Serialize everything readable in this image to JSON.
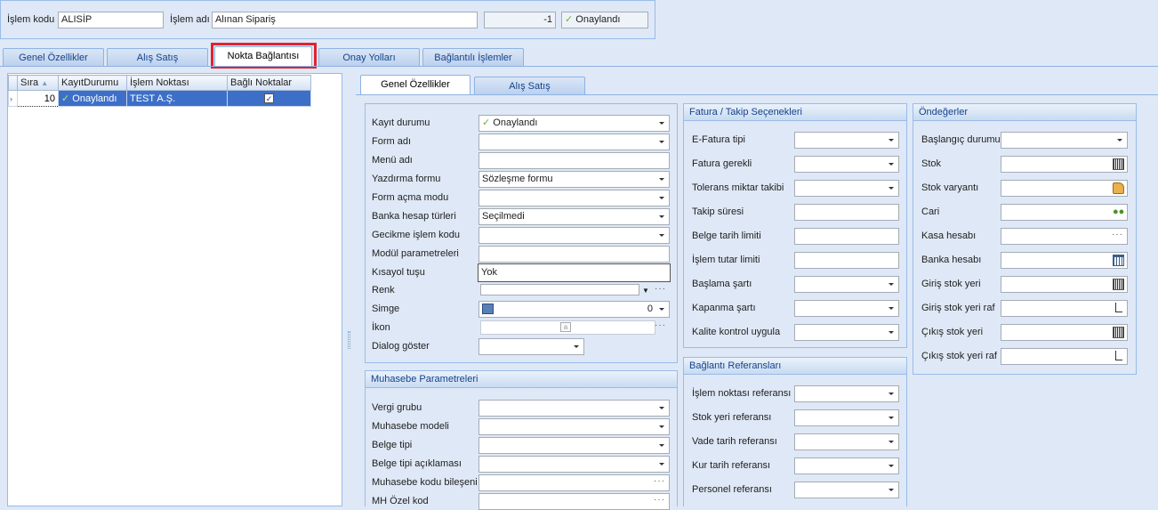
{
  "top": {
    "islem_kodu_label": "İşlem kodu",
    "islem_kodu_value": "ALISİP",
    "islem_adi_label": "İşlem adı",
    "islem_adi_value": "Alınan Sipariş",
    "number_value": "-1",
    "status_value": "Onaylandı"
  },
  "main_tabs": [
    "Genel Özellikler",
    "Alış Satış",
    "Nokta Bağlantısı",
    "Onay Yolları",
    "Bağlantılı İşlemler"
  ],
  "grid": {
    "headers": [
      "Sıra",
      "KayıtDurumu",
      "İşlem Noktası",
      "Bağlı Noktalar"
    ],
    "row": {
      "sira": "10",
      "durum": "Onaylandı",
      "nokta": "TEST A.Ş.",
      "bagli": "✓"
    }
  },
  "sub_tabs": [
    "Genel Özellikler",
    "Alış Satış"
  ],
  "genel": {
    "labels": [
      "Kayıt durumu",
      "Form adı",
      "Menü adı",
      "Yazdırma formu",
      "Form açma modu",
      "Banka hesap türleri",
      "Gecikme işlem kodu",
      "Modül parametreleri",
      "Kısayol tuşu",
      "Renk",
      "Simge",
      "İkon",
      "Dialog göster"
    ],
    "kayit_durumu": "Onaylandı",
    "yazdirma_formu": "Sözleşme formu",
    "banka_hesap": "Seçilmedi",
    "kisayol": "Yok",
    "simge_value": "0"
  },
  "muhasebe": {
    "title": "Muhasebe Parametreleri",
    "labels": [
      "Vergi grubu",
      "Muhasebe modeli",
      "Belge tipi",
      "Belge tipi açıklaması",
      "Muhasebe kodu bileşeni",
      "MH Özel kod"
    ]
  },
  "fatura": {
    "title": "Fatura / Takip Seçenekleri",
    "labels": [
      "E-Fatura tipi",
      "Fatura gerekli",
      "Tolerans miktar takibi",
      "Takip süresi",
      "Belge tarih limiti",
      "İşlem tutar limiti",
      "Başlama şartı",
      "Kapanma şartı",
      "Kalite kontrol uygula"
    ]
  },
  "baglanti": {
    "title": "Bağlantı Referansları",
    "labels": [
      "İşlem noktası referansı",
      "Stok yeri referansı",
      "Vade tarih referansı",
      "Kur tarih referansı",
      "Personel referansı"
    ]
  },
  "ondeger": {
    "title": "Öndeğerler",
    "labels": [
      "Başlangıç durumu",
      "Stok",
      "Stok varyantı",
      "Cari",
      "Kasa hesabı",
      "Banka hesabı",
      "Giriş stok yeri",
      "Giriş stok yeri raf",
      "Çıkış stok yeri",
      "Çıkış stok yeri raf"
    ]
  },
  "colors": {
    "accent": "#15428b",
    "highlight": "#e3232c",
    "selection": "#3d6fc8"
  }
}
